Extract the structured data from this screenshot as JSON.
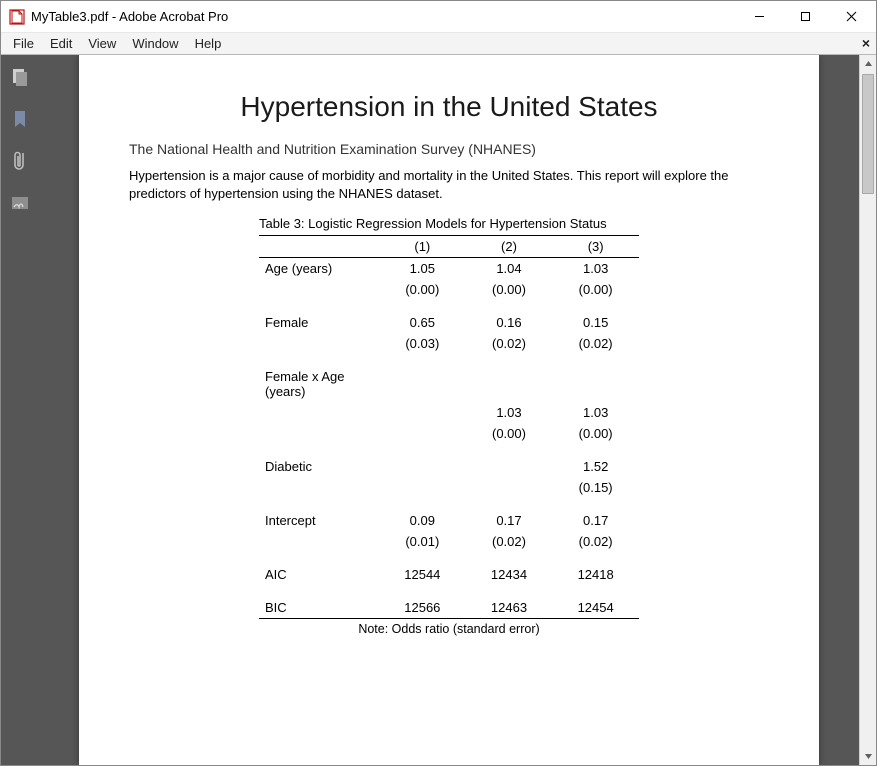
{
  "window": {
    "title": "MyTable3.pdf - Adobe Acrobat Pro"
  },
  "menu": {
    "items": [
      "File",
      "Edit",
      "View",
      "Window",
      "Help"
    ]
  },
  "sidebar": {
    "icons": [
      "pages-icon",
      "bookmark-icon",
      "attachments-icon",
      "signatures-icon"
    ]
  },
  "document": {
    "title": "Hypertension in the United States",
    "subtitle": "The National Health and Nutrition Examination Survey (NHANES)",
    "paragraph": "Hypertension is a major cause of morbidity and mortality in the United States.  This report will explore the predictors of hypertension using the NHANES dataset.",
    "table": {
      "caption": "Table 3: Logistic Regression Models for Hypertension Status",
      "model_headers": [
        "(1)",
        "(2)",
        "(3)"
      ],
      "rows": [
        {
          "label": "Age (years)",
          "coef": [
            "1.05",
            "1.04",
            "1.03"
          ],
          "se": [
            "(0.00)",
            "(0.00)",
            "(0.00)"
          ]
        },
        {
          "label": "Female",
          "coef": [
            "0.65",
            "0.16",
            "0.15"
          ],
          "se": [
            "(0.03)",
            "(0.02)",
            "(0.02)"
          ]
        },
        {
          "label": "Female x Age (years)",
          "coef": [
            "",
            "1.03",
            "1.03"
          ],
          "se": [
            "",
            "(0.00)",
            "(0.00)"
          ]
        },
        {
          "label": "Diabetic",
          "coef": [
            "",
            "",
            "1.52"
          ],
          "se": [
            "",
            "",
            "(0.15)"
          ]
        },
        {
          "label": "Intercept",
          "coef": [
            "0.09",
            "0.17",
            "0.17"
          ],
          "se": [
            "(0.01)",
            "(0.02)",
            "(0.02)"
          ]
        }
      ],
      "stats": [
        {
          "label": "AIC",
          "vals": [
            "12544",
            "12434",
            "12418"
          ]
        },
        {
          "label": "BIC",
          "vals": [
            "12566",
            "12463",
            "12454"
          ]
        }
      ],
      "note": "Note: Odds ratio (standard error)"
    }
  }
}
